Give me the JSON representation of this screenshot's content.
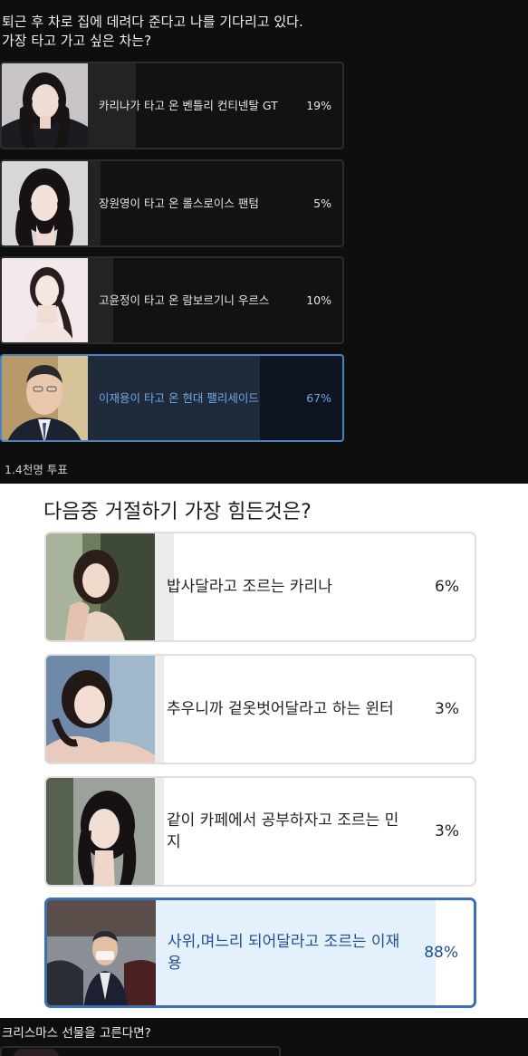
{
  "poll1": {
    "question_line1": "퇴근 후 차로 집에 데려다 준다고 나를 기다리고 있다.",
    "question_line2": "가장 타고 가고 싶은 차는?",
    "options": [
      {
        "label": "카리나가 타고 온 벤틀리 컨티넨탈 GT",
        "percent_text": "19%",
        "percent": 19,
        "selected": false
      },
      {
        "label": "장원영이 타고 온 롤스로이스 팬텀",
        "percent_text": "5%",
        "percent": 5,
        "selected": false
      },
      {
        "label": "고윤정이 타고 온 람보르기니 우르스",
        "percent_text": "10%",
        "percent": 10,
        "selected": false
      },
      {
        "label": "이재용이 타고 온 현대 팰리세이드",
        "percent_text": "67%",
        "percent": 67,
        "selected": true
      }
    ],
    "votes": "1.4천명 투표"
  },
  "poll2": {
    "question": "다음중 거절하기 가장 힘든것은?",
    "options": [
      {
        "label": "밥사달라고 조르는 카리나",
        "percent_text": "6%",
        "percent": 6,
        "selected": false
      },
      {
        "label": "추우니까 겉옷벗어달라고 하는 윈터",
        "percent_text": "3%",
        "percent": 3,
        "selected": false
      },
      {
        "label": "같이 카페에서 공부하자고 조르는 민지",
        "percent_text": "3%",
        "percent": 3,
        "selected": false
      },
      {
        "label": "사위,며느리 되어달라고 조르는 이재용",
        "percent_text": "88%",
        "percent": 88,
        "selected": true
      }
    ]
  },
  "poll3": {
    "question": "크리스마스 선물을 고른다면?"
  },
  "colors": {
    "dark_bg": "#0e0e0f",
    "dark_selected_accent": "#4a83c4",
    "light_selected_accent": "#3a6fb8",
    "light_selected_fill": "#e4f0fb"
  }
}
